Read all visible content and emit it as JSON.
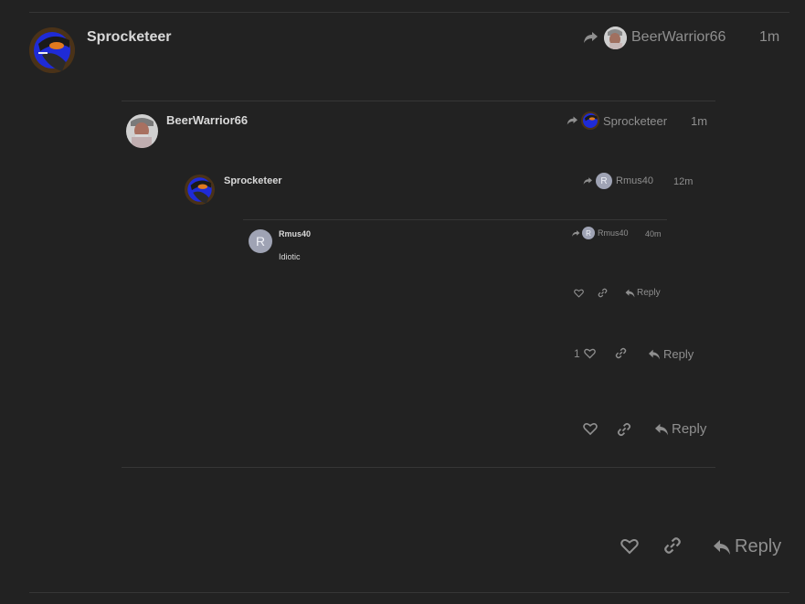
{
  "colors": {
    "background": "#222222",
    "divider": "#363636",
    "username": "#d9d9d9",
    "muted": "#8f8f8f",
    "letter_avatar": "#9fa3b4"
  },
  "level1": {
    "username": "Sprocketeer",
    "reply_to_user": "BeerWarrior66",
    "time": "1m",
    "actions": {
      "like_icon": "heart-icon",
      "link_icon": "link-icon",
      "reply_label": "Reply"
    }
  },
  "level2": {
    "username": "BeerWarrior66",
    "reply_to_user": "Sprocketeer",
    "time": "1m",
    "actions": {
      "reply_label": "Reply"
    }
  },
  "level3": {
    "username": "Sprocketeer",
    "reply_to_user": "Rmus40",
    "reply_to_avatar_letter": "R",
    "time": "12m",
    "actions": {
      "like_count": "1",
      "reply_label": "Reply"
    }
  },
  "level4": {
    "username": "Rmus40",
    "avatar_letter": "R",
    "reply_to_user": "Rmus40",
    "reply_to_avatar_letter": "R",
    "time": "40m",
    "body": "Idiotic",
    "actions": {
      "reply_label": "Reply"
    }
  }
}
